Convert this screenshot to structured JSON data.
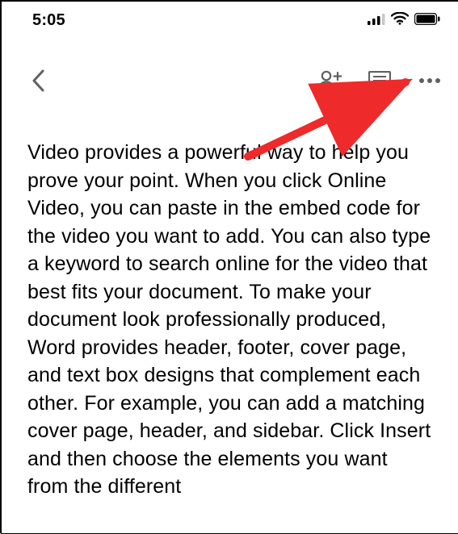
{
  "status_bar": {
    "time": "5:05"
  },
  "document": {
    "body_text": "Video provides a powerful way to help you prove your point. When you click Online Video, you can paste in the embed code for the video you want to add. You can also type a keyword to search online for the video that best fits your document. To make your document look professionally produced, Word provides header, footer, cover page, and text box designs that complement each other. For example, you can add a matching cover page, header, and sidebar. Click Insert and then choose the elements you want from the different"
  }
}
